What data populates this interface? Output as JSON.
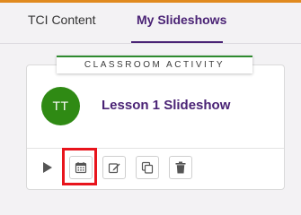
{
  "tabs": {
    "tci_label": "TCI Content",
    "my_label": "My Slideshows"
  },
  "card": {
    "activity_label": "CLASSROOM ACTIVITY",
    "avatar_initials": "TT",
    "title": "Lesson 1 Slideshow"
  },
  "toolbar": {
    "icons": [
      "play-icon",
      "calendar-icon",
      "edit-icon",
      "copy-icon",
      "trash-icon"
    ],
    "highlighted_button": "calendar-icon"
  },
  "colors": {
    "accent_orange": "#e08a1f",
    "brand_purple": "#4a2375",
    "activity_green": "#2e8a2e",
    "avatar_green": "#2f8a14",
    "highlight_red": "#e8141c"
  }
}
